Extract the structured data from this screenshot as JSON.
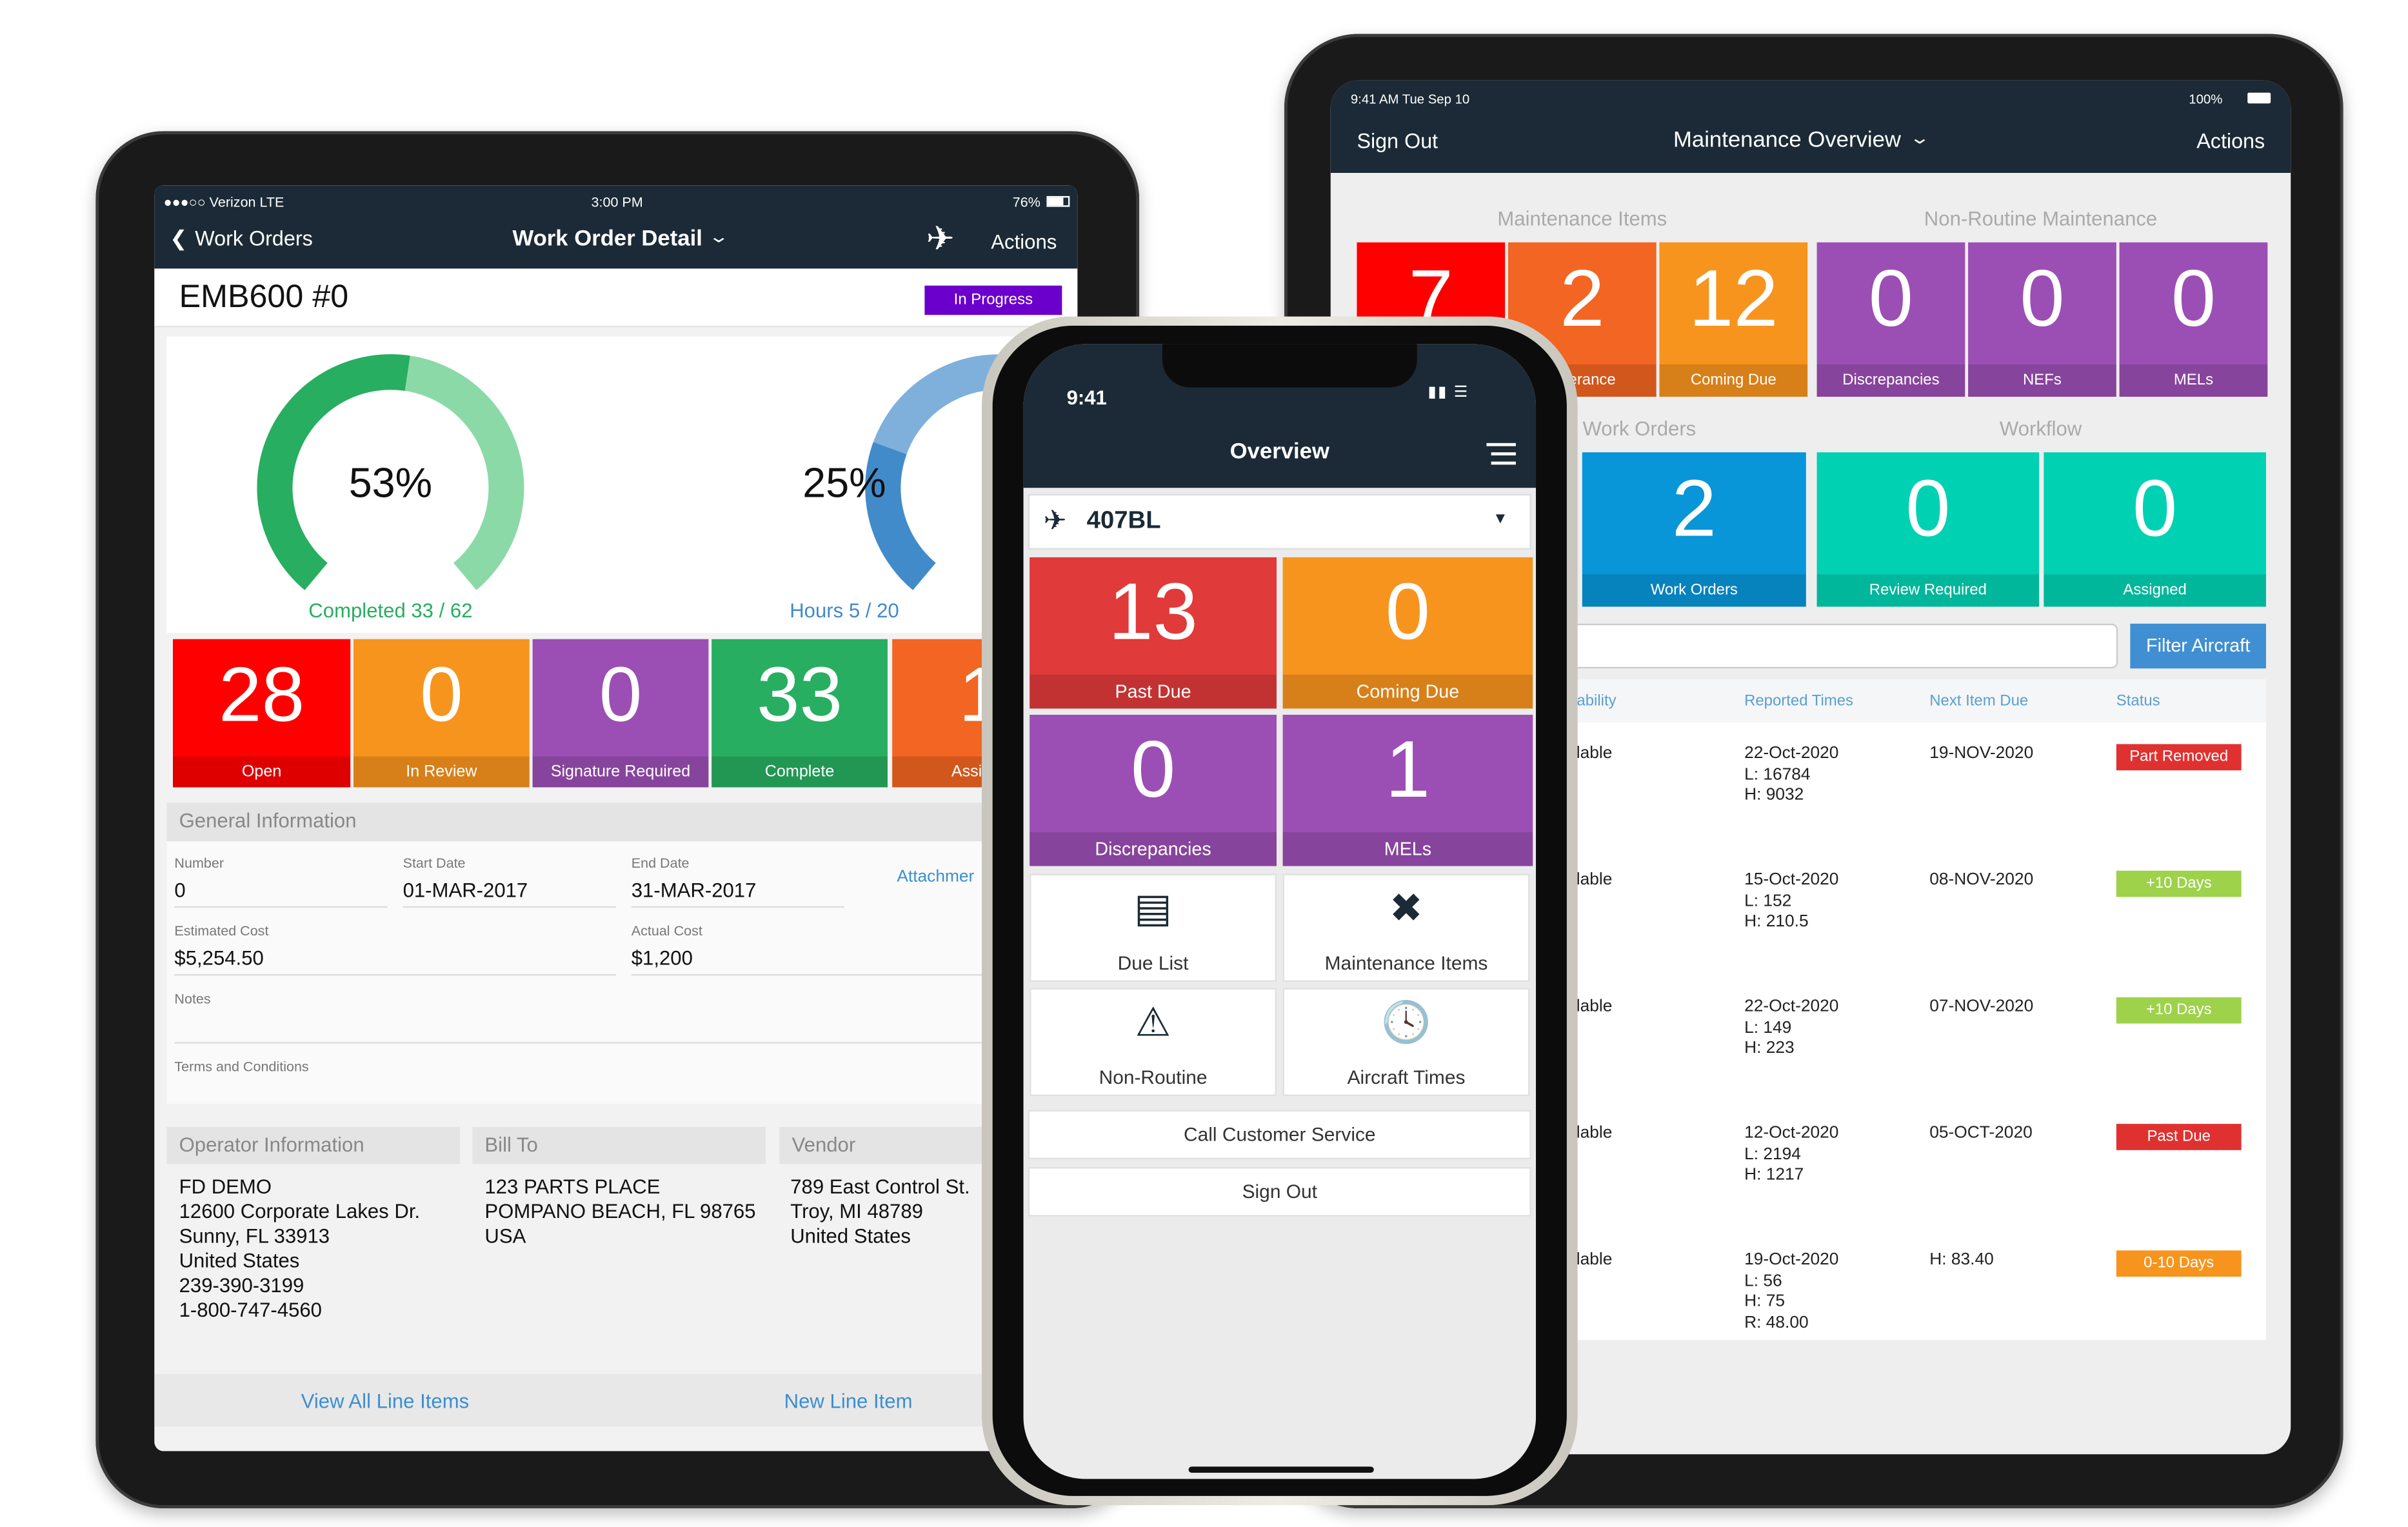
{
  "left_tablet": {
    "status": {
      "carrier": "●●●○○ Verizon  LTE",
      "time": "3:00 PM",
      "battery": "76%"
    },
    "nav": {
      "back": "Work Orders",
      "title": "Work Order Detail",
      "actions": "Actions",
      "plane_icon": "airplane-icon"
    },
    "work_order": {
      "title": "EMB600 #0",
      "status": "In Progress",
      "status_color": "#6b00cc"
    },
    "gauges": [
      {
        "value_text": "53%",
        "percent": 53,
        "caption": "Completed 33 / 62",
        "color": "#27ae60",
        "track": "#8cd9a8"
      },
      {
        "value_text": "25%",
        "percent": 25,
        "caption": "Hours 5 / 20",
        "color": "#428bca",
        "track": "#7fb0dc"
      }
    ],
    "tiles": [
      {
        "value": "28",
        "label": "Open",
        "color": "#ff0000"
      },
      {
        "value": "0",
        "label": "In Review",
        "color": "#f7941d"
      },
      {
        "value": "0",
        "label": "Signature Required",
        "color": "#9b4fb4"
      },
      {
        "value": "33",
        "label": "Complete",
        "color": "#27ae60"
      },
      {
        "value": "1",
        "label": "Assigne",
        "color": "#f26522"
      }
    ],
    "general": {
      "header": "General Information",
      "number_label": "Number",
      "number": "0",
      "start_label": "Start Date",
      "start": "01-MAR-2017",
      "end_label": "End Date",
      "end": "31-MAR-2017",
      "attachments": "Attachmer",
      "est_label": "Estimated Cost",
      "est": "$5,254.50",
      "act_label": "Actual Cost",
      "act": "$1,200",
      "notes_label": "Notes",
      "terms_label": "Terms and Conditions"
    },
    "operator": {
      "header": "Operator Information",
      "lines": [
        "FD DEMO",
        "12600 Corporate Lakes Dr.",
        "Sunny, FL 33913",
        "United States",
        "239-390-3199",
        "1-800-747-4560"
      ]
    },
    "bill_to": {
      "header": "Bill To",
      "lines": [
        "123 PARTS PLACE",
        "POMPANO BEACH, FL 98765",
        "USA"
      ]
    },
    "vendor": {
      "header": "Vendor",
      "lines": [
        "789 East Control St.",
        "Troy, MI 48789",
        "United States"
      ]
    },
    "footer": {
      "view_all": "View All Line Items",
      "new_item": "New Line Item"
    }
  },
  "right_tablet": {
    "status": {
      "time": "9:41 AM   Tue Sep 10",
      "battery": "100%"
    },
    "nav": {
      "sign_out": "Sign Out",
      "title": "Maintenance Overview",
      "actions": "Actions"
    },
    "sections": {
      "maintenance": "Maintenance Items",
      "non_routine": "Non-Routine Maintenance",
      "work_orders": "Work Orders",
      "workflow": "Workflow"
    },
    "tiles_row1": [
      {
        "value": "7",
        "label": "",
        "color": "#ff0000"
      },
      {
        "value": "2",
        "label": "Tolerance",
        "color": "#f26522"
      },
      {
        "value": "12",
        "label": "Coming Due",
        "color": "#f7941d"
      },
      {
        "value": "0",
        "label": "Discrepancies",
        "color": "#9b4fb4"
      },
      {
        "value": "0",
        "label": "NEFs",
        "color": "#9b4fb4"
      },
      {
        "value": "0",
        "label": "MELs",
        "color": "#9b4fb4"
      }
    ],
    "tiles_row2": [
      {
        "value": "2",
        "label": "Work Orders",
        "color": "#0896d8"
      },
      {
        "value": "0",
        "label": "Review Required",
        "color": "#00d1b2"
      },
      {
        "value": "0",
        "label": "Assigned",
        "color": "#00d1b2"
      }
    ],
    "filter": {
      "placeholder": "",
      "button": "Filter Aircraft"
    },
    "table": {
      "headers": [
        "Availability",
        "Reported Times",
        "Next Item Due",
        "Status"
      ],
      "rows": [
        {
          "availability": "Available",
          "reported": [
            "22-Oct-2020",
            "L: 16784",
            "H: 9032"
          ],
          "next": "19-NOV-2020",
          "status": "Part Removed",
          "status_color": "#e03131"
        },
        {
          "availability": "Available",
          "reported": [
            "15-Oct-2020",
            "L: 152",
            "H: 210.5"
          ],
          "next": "08-NOV-2020",
          "status": "+10 Days",
          "status_color": "#9ed24a"
        },
        {
          "availability": "Available",
          "reported": [
            "22-Oct-2020",
            "L: 149",
            "H: 223"
          ],
          "next": "07-NOV-2020",
          "status": "+10 Days",
          "status_color": "#9ed24a"
        },
        {
          "availability": "Available",
          "reported": [
            "12-Oct-2020",
            "L: 2194",
            "H: 1217"
          ],
          "next": "05-OCT-2020",
          "status": "Past Due",
          "status_color": "#e03131"
        },
        {
          "availability": "Available",
          "reported": [
            "19-Oct-2020",
            "L: 56",
            "H: 75",
            "R: 48.00"
          ],
          "next": "H: 83.40",
          "status": "0-10 Days",
          "status_color": "#f7941d"
        }
      ]
    }
  },
  "phone": {
    "status": {
      "time": "9:41"
    },
    "nav": {
      "title": "Overview"
    },
    "aircraft": "407BL",
    "tiles": [
      {
        "value": "13",
        "label": "Past Due",
        "color": "#e03a3a"
      },
      {
        "value": "0",
        "label": "Coming Due",
        "color": "#f7941d"
      },
      {
        "value": "0",
        "label": "Discrepancies",
        "color": "#9b4fb4"
      },
      {
        "value": "1",
        "label": "MELs",
        "color": "#9b4fb4"
      }
    ],
    "menu": [
      {
        "label": "Due List",
        "icon": "list-icon"
      },
      {
        "label": "Maintenance Items",
        "icon": "tools-icon"
      },
      {
        "label": "Non-Routine",
        "icon": "warning-icon"
      },
      {
        "label": "Aircraft Times",
        "icon": "clock-icon"
      }
    ],
    "call": "Call Customer Service",
    "sign_out": "Sign Out"
  }
}
